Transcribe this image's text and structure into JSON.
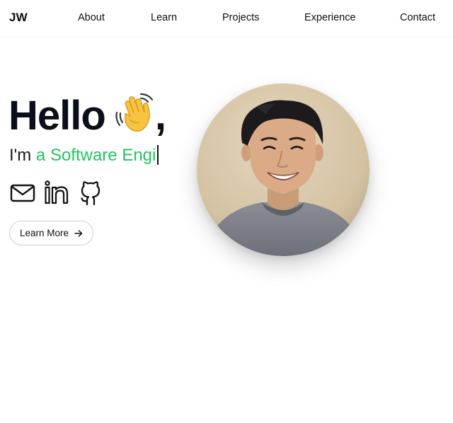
{
  "header": {
    "logo": "JW",
    "nav": {
      "about": "About",
      "learn": "Learn",
      "projects": "Projects",
      "experience": "Experience",
      "contact": "Contact"
    }
  },
  "hero": {
    "greeting": "Hello",
    "greeting_emoji": "waving-hand",
    "greeting_punct": ",",
    "intro_prefix": "I'm",
    "typed_text": "a Software Engi",
    "accent_color": "#22c55e",
    "socials": {
      "mail": "mail-icon",
      "linkedin": "linkedin-icon",
      "github": "github-icon"
    },
    "cta_label": "Learn More",
    "cta_icon": "arrow-right-icon"
  }
}
